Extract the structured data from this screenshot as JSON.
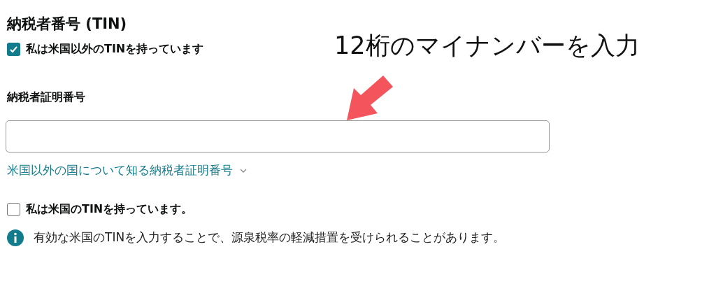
{
  "section": {
    "title": "納税者番号 (TIN)"
  },
  "checkboxes_top": [
    {
      "label": "私は米国以外のTINを持っています",
      "checked": true
    }
  ],
  "field": {
    "label": "納税者証明番号"
  },
  "link": {
    "label": "米国以外の国について知る納税者証明番号"
  },
  "checkboxes_bottom": [
    {
      "label": "私は米国のTINを持っています。",
      "checked": false
    }
  ],
  "info": {
    "text": "有効な米国のTINを入力することで、源泉税率の軽減措置を受けられることがあります。"
  },
  "annotation": {
    "text": "12桁のマイナンバーを入力"
  }
}
